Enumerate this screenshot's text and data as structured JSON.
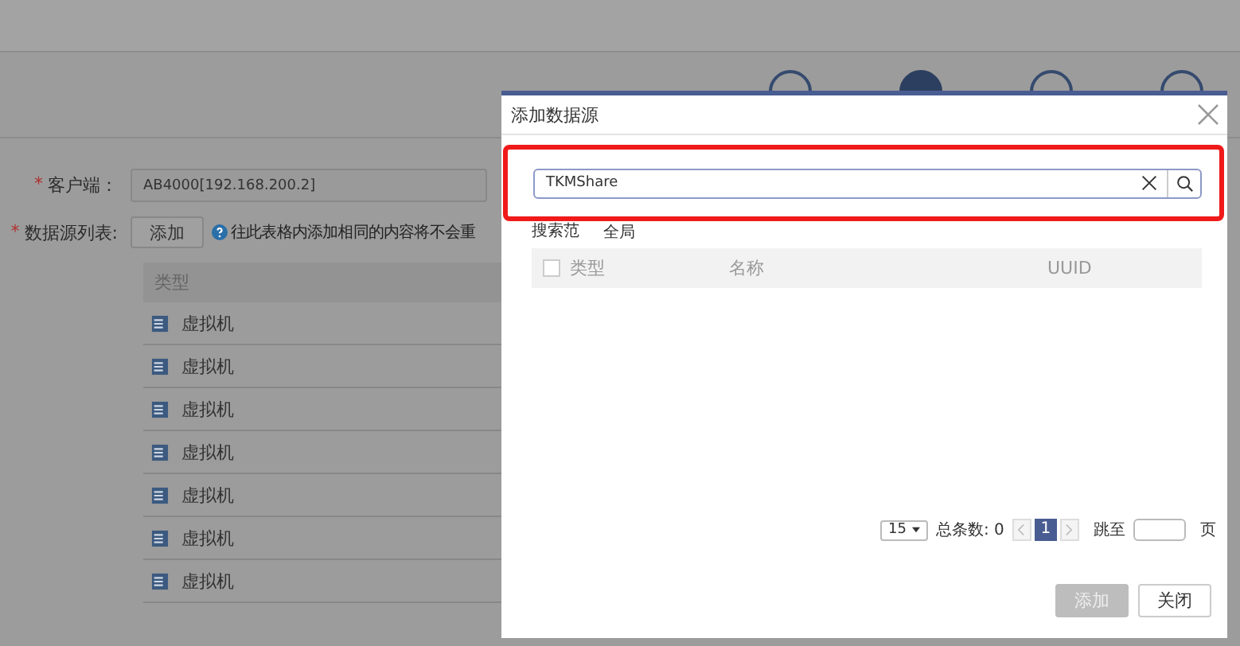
{
  "page": {
    "steps": [
      {
        "selected": false
      },
      {
        "selected": true
      },
      {
        "selected": false
      },
      {
        "selected": false
      }
    ],
    "form": {
      "required_mark": "*",
      "client_label": "客户端：",
      "client_value": "AB4000[192.168.200.2]",
      "list_label": "数据源列表:",
      "add_button": "添加",
      "hint": "往此表格内添加相同的内容将不会重"
    },
    "table": {
      "columns": [
        "类型"
      ],
      "rows": [
        {
          "type": "虚拟机"
        },
        {
          "type": "虚拟机"
        },
        {
          "type": "虚拟机"
        },
        {
          "type": "虚拟机"
        },
        {
          "type": "虚拟机"
        },
        {
          "type": "虚拟机"
        },
        {
          "type": "虚拟机"
        }
      ]
    }
  },
  "dialog": {
    "title": "添加数据源",
    "search": {
      "value": "TKMShare",
      "highlighted": true
    },
    "scope_label": "搜索范",
    "scope_value": "全局",
    "table": {
      "select_all_checked": false,
      "columns": [
        "类型",
        "名称",
        "UUID"
      ]
    },
    "pagination": {
      "page_size": "15",
      "total": "总条数: 0",
      "current_page": "1",
      "jump_label": "跳至",
      "page_suffix": "页"
    },
    "buttons": [
      {
        "label": "添加",
        "disabled": true
      },
      {
        "label": "关闭",
        "disabled": false
      }
    ]
  }
}
